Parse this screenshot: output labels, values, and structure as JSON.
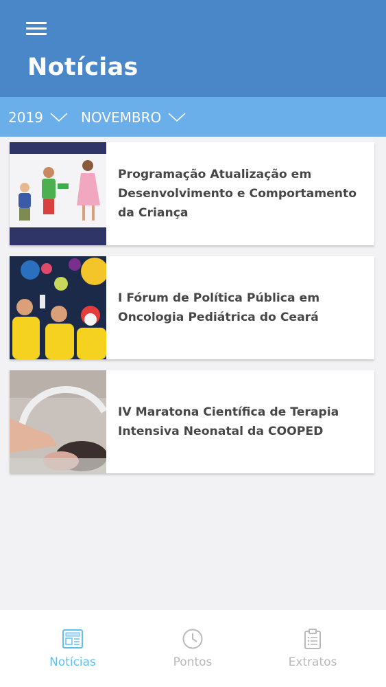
{
  "header": {
    "title": "Notícias",
    "color": "#4a87c8"
  },
  "filters": {
    "year": "2019",
    "month": "NOVEMBRO",
    "color": "#6aaeea"
  },
  "news": [
    {
      "title": "Programação Atualização em Desenvolvimento e Comportamento da Criança",
      "thumb": "children-running-photo"
    },
    {
      "title": "I Fórum de Política Pública em Oncologia Pediátrica do Ceará",
      "thumb": "children-yellow-shirts-photo"
    },
    {
      "title": "IV Maratona Científica de Terapia Intensiva Neonatal da COOPED",
      "thumb": "newborn-incubator-photo"
    }
  ],
  "bottom_nav": [
    {
      "label": "Notícias",
      "icon": "newspaper-icon",
      "active": true
    },
    {
      "label": "Pontos",
      "icon": "clock-icon",
      "active": false
    },
    {
      "label": "Extratos",
      "icon": "clipboard-list-icon",
      "active": false
    }
  ],
  "colors": {
    "accent": "#5fc0f0",
    "inactive": "#b9b9b9"
  }
}
